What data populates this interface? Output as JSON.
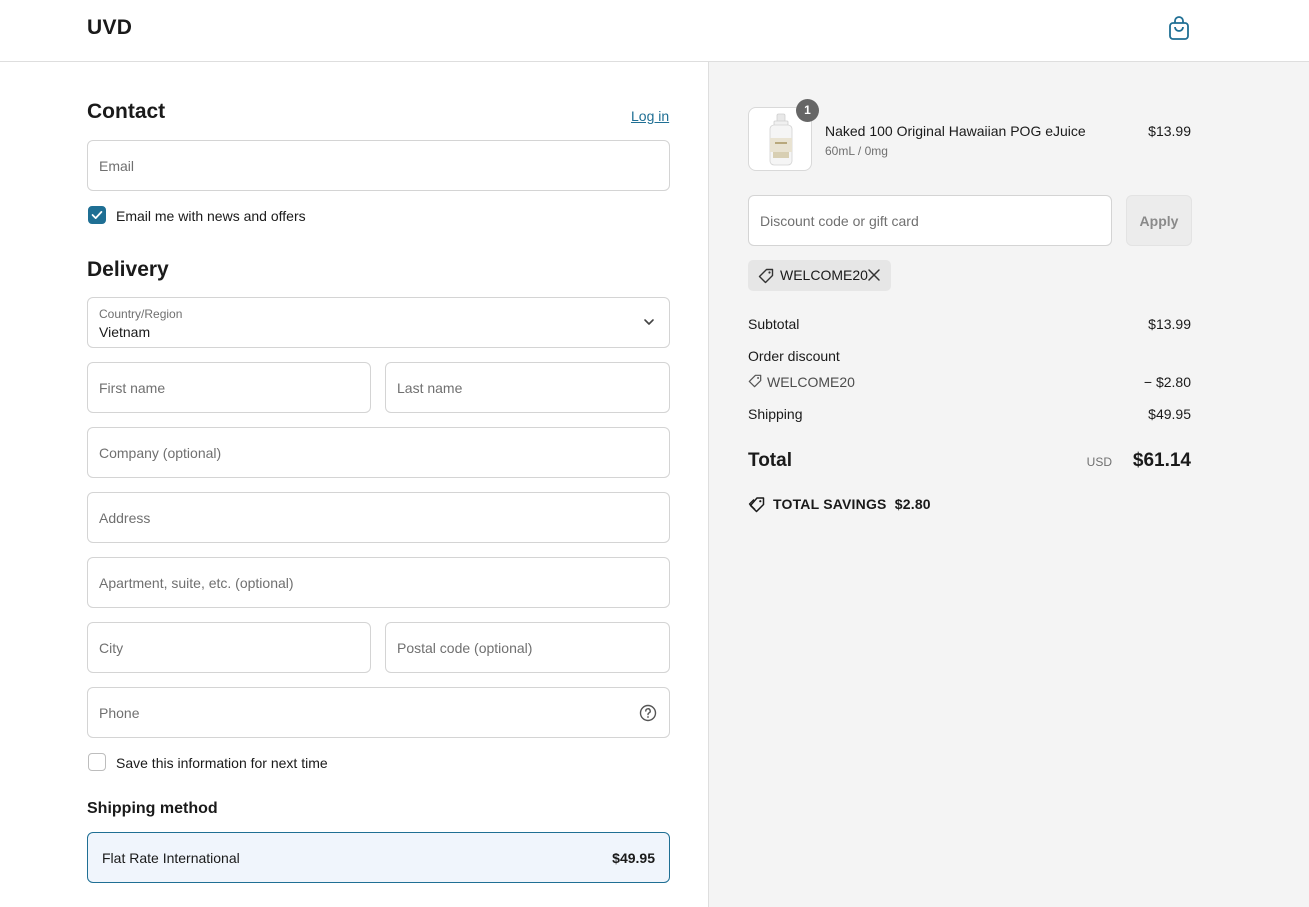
{
  "header": {
    "brand": "UVD"
  },
  "contact": {
    "title": "Contact",
    "login_label": "Log in",
    "email_placeholder": "Email",
    "newsletter_label": "Email me with news and offers",
    "newsletter_checked": true
  },
  "delivery": {
    "title": "Delivery",
    "country_label": "Country/Region",
    "country_value": "Vietnam",
    "first_name_placeholder": "First name",
    "last_name_placeholder": "Last name",
    "company_placeholder": "Company (optional)",
    "address_placeholder": "Address",
    "apartment_placeholder": "Apartment, suite, etc. (optional)",
    "city_placeholder": "City",
    "postal_placeholder": "Postal code (optional)",
    "phone_placeholder": "Phone",
    "save_info_label": "Save this information for next time",
    "save_info_checked": false
  },
  "shipping": {
    "title": "Shipping method",
    "option_name": "Flat Rate International",
    "option_price": "$49.95"
  },
  "summary": {
    "item": {
      "quantity": "1",
      "name": "Naked 100 Original Hawaiian POG eJuice",
      "variant": "60mL / 0mg",
      "price": "$13.99"
    },
    "discount_placeholder": "Discount code or gift card",
    "apply_label": "Apply",
    "applied_code": "WELCOME20",
    "subtotal_label": "Subtotal",
    "subtotal_value": "$13.99",
    "order_discount_label": "Order discount",
    "discount_code": "WELCOME20",
    "discount_value": "− $2.80",
    "shipping_label": "Shipping",
    "shipping_value": "$49.95",
    "total_label": "Total",
    "currency": "USD",
    "total_value": "$61.14",
    "savings_text": "TOTAL SAVINGS  $2.80"
  },
  "colors": {
    "accent": "#1f6f94",
    "selected_bg": "#f0f5fc",
    "summary_bg": "#f4f4f4"
  },
  "icons": {
    "cart": "shopping-bag-icon",
    "dropdown": "chevron-down-icon",
    "help": "question-circle-icon",
    "tag": "tag-icon",
    "remove": "close-icon",
    "savings": "price-tags-icon"
  }
}
